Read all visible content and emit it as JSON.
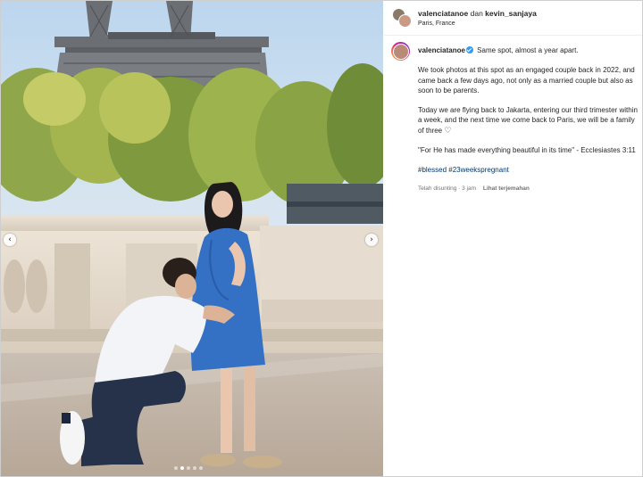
{
  "post": {
    "header": {
      "user1": "valenciatanoe",
      "conjunction": "dan",
      "user2": "kevin_sanjaya",
      "location": "Paris, France",
      "more_icon": "more-horizontal-icon"
    },
    "caption": {
      "username": "valenciatanoe",
      "verified_icon": "verified-badge-icon",
      "first_line": "Same spot, almost a year apart.",
      "paragraph1": "We took photos at this spot as an engaged couple back in 2022, and came back a few days ago, not only as a married couple but also as soon to be parents.",
      "paragraph2": "Today we are flying back to Jakarta, entering our third trimester within a week, and the next time we come back to Paris, we will be a family of three",
      "heart": "♡",
      "quote": "\"For He has made everything beautiful in its time\" - Ecclesiastes 3:11",
      "hashtag1": "#blessed",
      "hashtag2": "#23weekspregnant",
      "timestamp": "Telah disunting · 3 jam",
      "see_translation": "Lihat terjemahan"
    },
    "carousel": {
      "prev_icon": "‹",
      "next_icon": "›",
      "slides": 5,
      "active_index": 1
    }
  },
  "colors": {
    "link": "#00376b",
    "verified": "#3897f0",
    "muted": "#737373",
    "text": "#262626"
  }
}
